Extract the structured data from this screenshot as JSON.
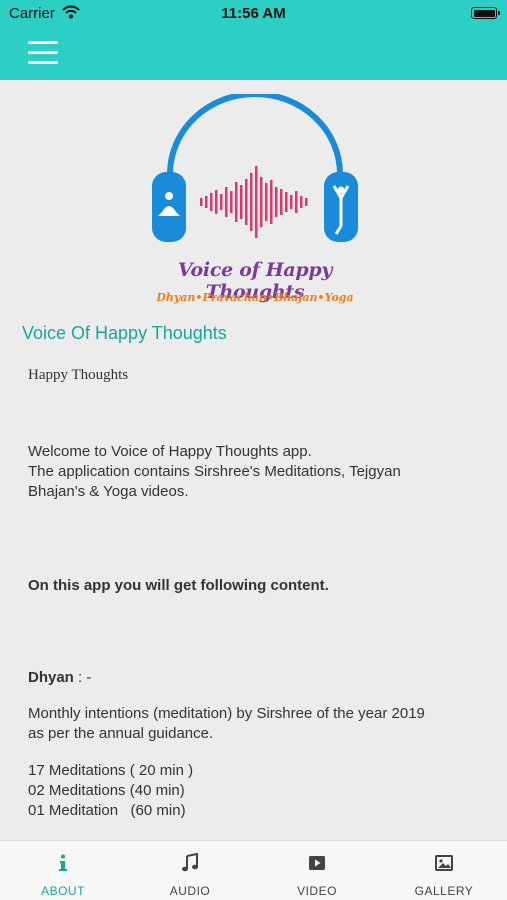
{
  "status_bar": {
    "carrier": "Carrier",
    "time": "11:56 AM"
  },
  "logo": {
    "title": "Voice of Happy Thoughts",
    "subtitle": "Dhyan•Pravachan•Bhajan•Yoga"
  },
  "main": {
    "heading": "Voice Of Happy Thoughts",
    "subheading": "Happy Thoughts",
    "welcome": [
      "Welcome to Voice of Happy Thoughts app.",
      "The application contains Sirshree's Meditations, Tejgyan",
      "Bhajan's & Yoga videos."
    ],
    "content_intro": "On this app you will get following content.",
    "dhyan_label": "Dhyan",
    "dhyan_suffix": " : -",
    "intentions": [
      "Monthly intentions (meditation) by Sirshree of the year 2019",
      "as per the annual guidance."
    ],
    "meditations": [
      "17 Meditations ( 20 min )",
      "02 Meditations (40 min)",
      "01 Meditation   (60 min)"
    ]
  },
  "tabs": [
    {
      "label": "ABOUT",
      "icon": "info-icon",
      "active": true
    },
    {
      "label": "AUDIO",
      "icon": "music-note-icon",
      "active": false
    },
    {
      "label": "VIDEO",
      "icon": "video-play-icon",
      "active": false
    },
    {
      "label": "GALLERY",
      "icon": "gallery-image-icon",
      "active": false
    }
  ],
  "colors": {
    "accent": "#2ccfc4",
    "heading": "#1aa59b",
    "logo_blue": "#1a8bd8",
    "logo_purple": "#7a3c98",
    "logo_orange": "#ef7d1a",
    "logo_pink": "#d93a6a"
  }
}
